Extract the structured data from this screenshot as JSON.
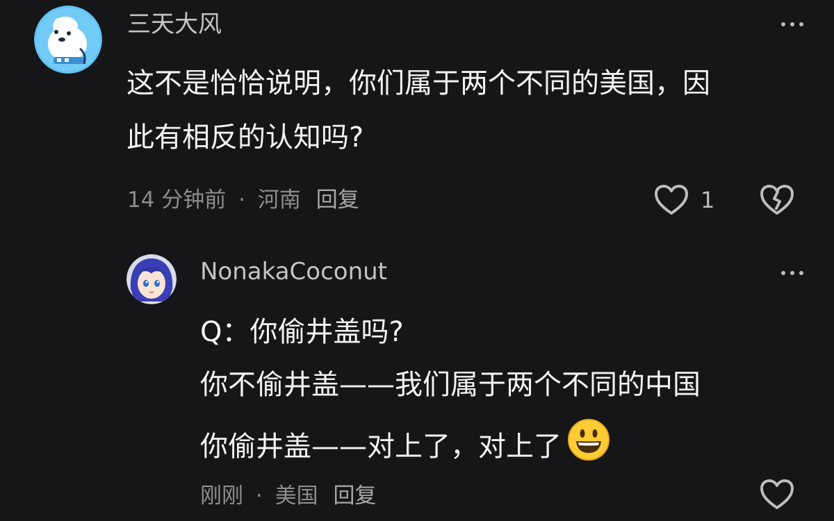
{
  "comments": [
    {
      "username": "三天大风",
      "text_lines": [
        "这不是恰恰说明，你们属于两个不同的美国，因",
        "此有相反的认知吗?"
      ],
      "time": "14 分钟前",
      "separator": "·",
      "location": "河南",
      "reply_label": "回复",
      "like_count": "1",
      "avatar_icon": "polar-bear-avatar",
      "more_icon": "ellipsis-icon",
      "like_icon": "heart-outline-icon",
      "dislike_icon": "broken-heart-icon"
    },
    {
      "username": "NonakaCoconut",
      "text_lines": [
        "Q：你偷井盖吗?",
        "你不偷井盖——我们属于两个不同的中国",
        "你偷井盖——对上了，对上了"
      ],
      "emoji": "😄",
      "time": "刚刚",
      "separator": "·",
      "location": "美国",
      "reply_label": "回复",
      "avatar_icon": "anime-girl-avatar",
      "more_icon": "ellipsis-icon",
      "like_icon": "heart-outline-icon"
    }
  ],
  "colors": {
    "background": "#161618",
    "text_primary": "#f4f4f4",
    "text_secondary": "#8d8d8d",
    "username": "#c4c4c4",
    "icon": "#bdbdbd"
  }
}
